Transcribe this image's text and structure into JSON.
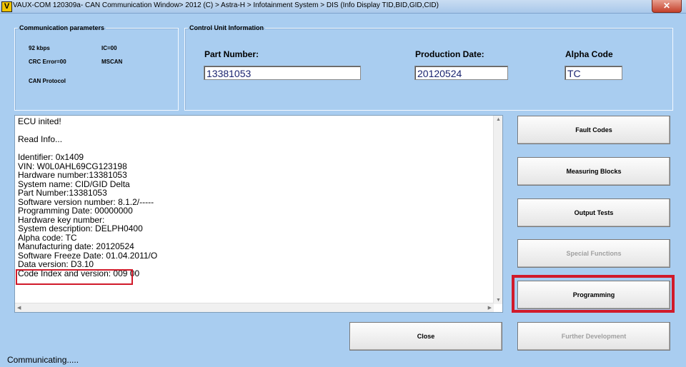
{
  "window": {
    "icon_letter": "V",
    "title": "VAUX-COM 120309a- CAN Communication Window> 2012 (C) > Astra-H > Infotainment System > DIS (Info Display TID,BID,GID,CID)",
    "close_label": "✕"
  },
  "comm": {
    "legend": "Communication parameters",
    "baud": "92 kbps",
    "ic": "IC=00",
    "crc": "CRC Error=00",
    "mscan": "MSCAN",
    "protocol": "CAN Protocol"
  },
  "control_unit": {
    "legend": "Control Unit Information",
    "part_label": "Part Number:",
    "part_value": "13381053",
    "prod_label": "Production Date:",
    "prod_value": "20120524",
    "alpha_label": "Alpha Code",
    "alpha_value": "TC"
  },
  "log": {
    "lines": [
      "ECU inited!",
      "",
      "Read Info...",
      "",
      "Identifier: 0x1409",
      "VIN: W0L0AHL69CG123198",
      "Hardware number:13381053",
      "System name: CID/GID Delta",
      "Part Number:13381053",
      "Software version number: 8.1.2/-----",
      "Programming Date: 00000000",
      "Hardware key number:",
      "System description: DELPH0400",
      "Alpha code: TC",
      "Manufacturing date: 20120524",
      "Software Freeze Date: 01.04.2011/O",
      "Data version: D3.10",
      "Code Index and version: 009 00"
    ]
  },
  "buttons": {
    "fault_codes": "Fault Codes",
    "measuring_blocks": "Measuring Blocks",
    "output_tests": "Output Tests",
    "special_functions": "Special Functions",
    "programming": "Programming",
    "further_development": "Further Development",
    "close": "Close"
  },
  "status": "Communicating.....",
  "colors": {
    "background": "#a9cdf0",
    "highlight": "#d11a2a",
    "field_text": "#1a2470"
  }
}
